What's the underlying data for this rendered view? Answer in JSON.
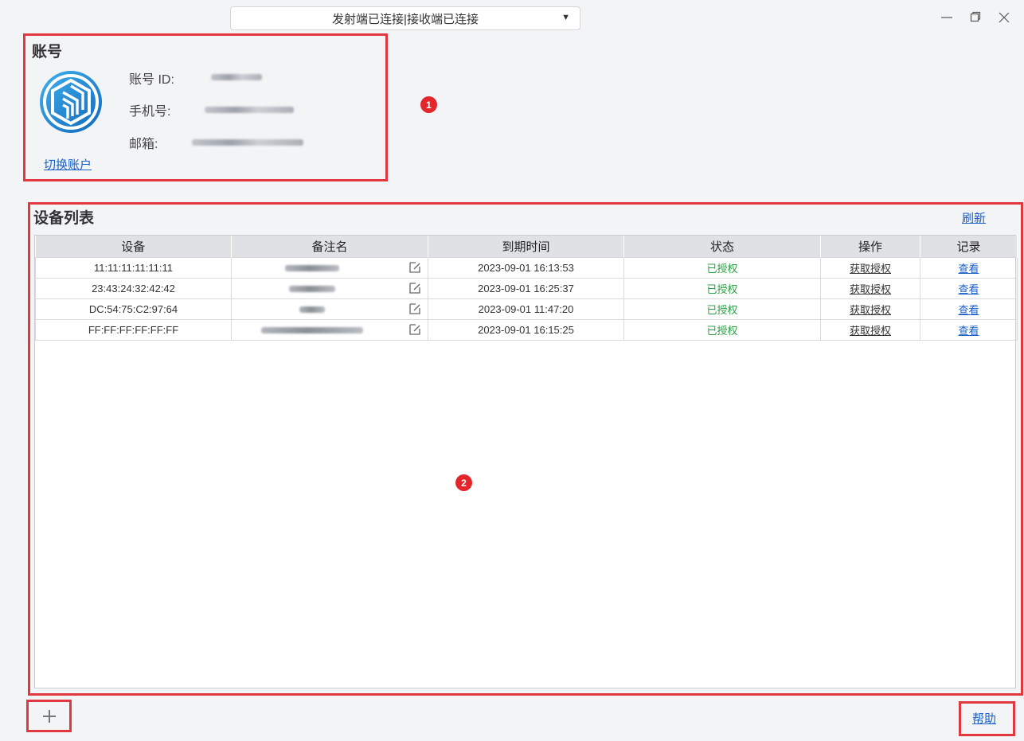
{
  "connection": {
    "status": "发射端已连接|接收端已连接",
    "dropdown_icon": "triangle-down"
  },
  "window": {
    "minimize_icon": "minimize-icon",
    "restore_icon": "restore-icon",
    "close_icon": "close-icon"
  },
  "account": {
    "title": "账号",
    "id_label": "账号 ID:",
    "phone_label": "手机号:",
    "email_label": "邮箱:",
    "switch_label": "切换账户",
    "logo_color": "#1e88c8"
  },
  "markers": [
    "1",
    "2"
  ],
  "devices": {
    "title": "设备列表",
    "refresh_label": "刷新",
    "columns": [
      "设备",
      "备注名",
      "到期时间",
      "状态",
      "操作",
      "记录"
    ],
    "rows": [
      {
        "device": "11:11:11:11:11:11",
        "expiry": "2023-09-01 16:13:53",
        "status": "已授权",
        "action": "获取授权",
        "record": "查看"
      },
      {
        "device": "23:43:24:32:42:42",
        "expiry": "2023-09-01 16:25:37",
        "status": "已授权",
        "action": "获取授权",
        "record": "查看"
      },
      {
        "device": "DC:54:75:C2:97:64",
        "expiry": "2023-09-01 11:47:20",
        "status": "已授权",
        "action": "获取授权",
        "record": "查看"
      },
      {
        "device": "FF:FF:FF:FF:FF:FF",
        "expiry": "2023-09-01 16:15:25",
        "status": "已授权",
        "action": "获取授权",
        "record": "查看"
      }
    ]
  },
  "footer": {
    "add_icon": "plus-icon",
    "help_label": "帮助"
  },
  "colors": {
    "highlight": "#e0383e",
    "link": "#1a5ec8",
    "status_ok": "#2aa043",
    "header_bg": "#dfe1e4"
  }
}
